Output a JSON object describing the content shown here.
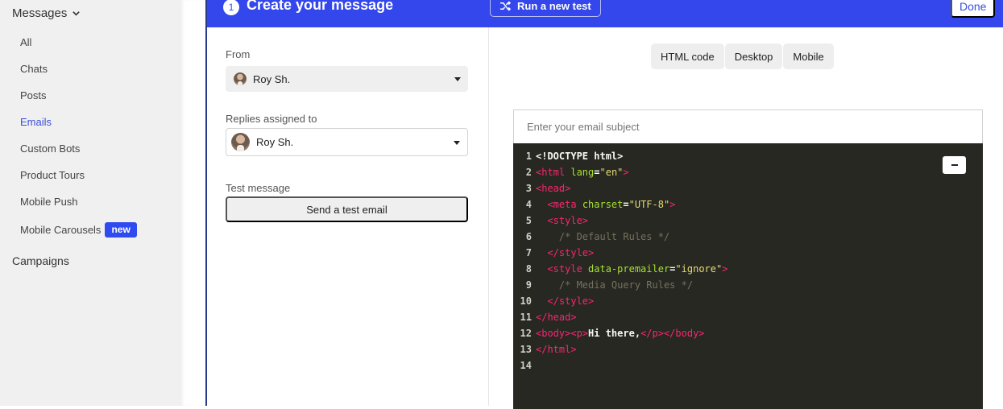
{
  "sidebar": {
    "section_title": "Messages",
    "items": [
      {
        "label": "All",
        "active": false
      },
      {
        "label": "Chats",
        "active": false
      },
      {
        "label": "Posts",
        "active": false
      },
      {
        "label": "Emails",
        "active": true
      },
      {
        "label": "Custom Bots",
        "active": false
      },
      {
        "label": "Product Tours",
        "active": false
      },
      {
        "label": "Mobile Push",
        "active": false
      },
      {
        "label": "Mobile Carousels",
        "active": false,
        "badge": "new"
      }
    ],
    "campaigns_label": "Campaigns"
  },
  "header": {
    "step_number": "1",
    "title": "Create your message",
    "run_test_label": "Run a new test",
    "run_test_icon": "shuffle-icon",
    "done_label": "Done"
  },
  "form": {
    "from_label": "From",
    "from_value": "Roy Sh.",
    "replies_label": "Replies assigned to",
    "replies_value": "Roy Sh.",
    "test_label": "Test message",
    "test_button": "Send a test email"
  },
  "preview": {
    "tabs": [
      "HTML code",
      "Desktop",
      "Mobile"
    ],
    "subject_placeholder": "Enter your email subject",
    "code_lines": [
      [
        {
          "t": "doctype",
          "s": "<!DOCTYPE html>"
        }
      ],
      [
        {
          "t": "tag",
          "s": "<html "
        },
        {
          "t": "attr",
          "s": "lang"
        },
        {
          "t": "plain",
          "s": "="
        },
        {
          "t": "str",
          "s": "\"en\""
        },
        {
          "t": "tag",
          "s": ">"
        }
      ],
      [
        {
          "t": "tag",
          "s": "<head>"
        }
      ],
      [
        {
          "t": "plain",
          "s": "  "
        },
        {
          "t": "tag",
          "s": "<meta "
        },
        {
          "t": "attr",
          "s": "charset"
        },
        {
          "t": "plain",
          "s": "="
        },
        {
          "t": "str",
          "s": "\"UTF-8\""
        },
        {
          "t": "tag",
          "s": ">"
        }
      ],
      [
        {
          "t": "plain",
          "s": "  "
        },
        {
          "t": "tag",
          "s": "<style>"
        }
      ],
      [
        {
          "t": "plain",
          "s": "    "
        },
        {
          "t": "cmt",
          "s": "/* Default Rules */"
        }
      ],
      [
        {
          "t": "plain",
          "s": "  "
        },
        {
          "t": "tag",
          "s": "</style>"
        }
      ],
      [
        {
          "t": "plain",
          "s": "  "
        },
        {
          "t": "tag",
          "s": "<style "
        },
        {
          "t": "attr",
          "s": "data-premailer"
        },
        {
          "t": "plain",
          "s": "="
        },
        {
          "t": "str",
          "s": "\"ignore\""
        },
        {
          "t": "tag",
          "s": ">"
        }
      ],
      [
        {
          "t": "plain",
          "s": "    "
        },
        {
          "t": "cmt",
          "s": "/* Media Query Rules */"
        }
      ],
      [
        {
          "t": "plain",
          "s": "  "
        },
        {
          "t": "tag",
          "s": "</style>"
        }
      ],
      [
        {
          "t": "tag",
          "s": "</head>"
        }
      ],
      [
        {
          "t": "tag",
          "s": "<body><p>"
        },
        {
          "t": "plain",
          "s": "Hi there,"
        },
        {
          "t": "tag",
          "s": "</p></body>"
        }
      ],
      [
        {
          "t": "tag",
          "s": "</html>"
        }
      ],
      []
    ]
  },
  "colors": {
    "brand": "#3347ec",
    "active_link": "#3a4fd9",
    "editor_bg": "#272822"
  }
}
